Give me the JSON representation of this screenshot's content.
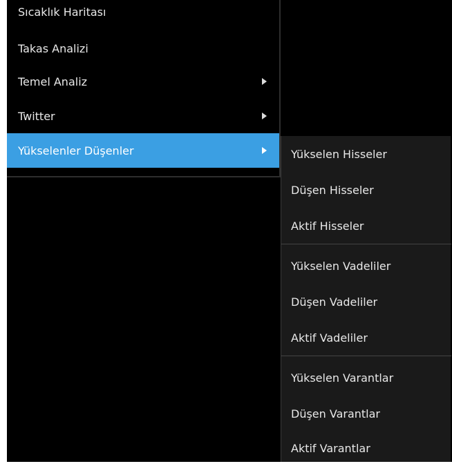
{
  "main_menu": {
    "items": [
      {
        "label": "Sıcaklık Haritası",
        "has_submenu": false,
        "highlighted": false
      },
      {
        "label": "Takas Analizi",
        "has_submenu": false,
        "highlighted": false
      },
      {
        "label": "Temel Analiz",
        "has_submenu": true,
        "highlighted": false
      },
      {
        "label": "Twitter",
        "has_submenu": true,
        "highlighted": false
      },
      {
        "label": "Yükselenler Düşenler",
        "has_submenu": true,
        "highlighted": true
      }
    ]
  },
  "submenu": {
    "groups": [
      {
        "items": [
          "Yükselen Hisseler",
          "Düşen Hisseler",
          "Aktif Hisseler"
        ]
      },
      {
        "items": [
          "Yükselen Vadeliler",
          "Düşen Vadeliler",
          "Aktif Vadeliler"
        ]
      },
      {
        "items": [
          "Yükselen Varantlar",
          "Düşen Varantlar",
          "Aktif Varantlar"
        ]
      }
    ]
  },
  "icons": {
    "submenu_indicator": "triangle-right-icon"
  },
  "colors": {
    "menu_background": "#000000",
    "submenu_background": "#1a1a1a",
    "highlight": "#3b9fe3",
    "text": "#e8e8e8",
    "divider": "#444444"
  }
}
